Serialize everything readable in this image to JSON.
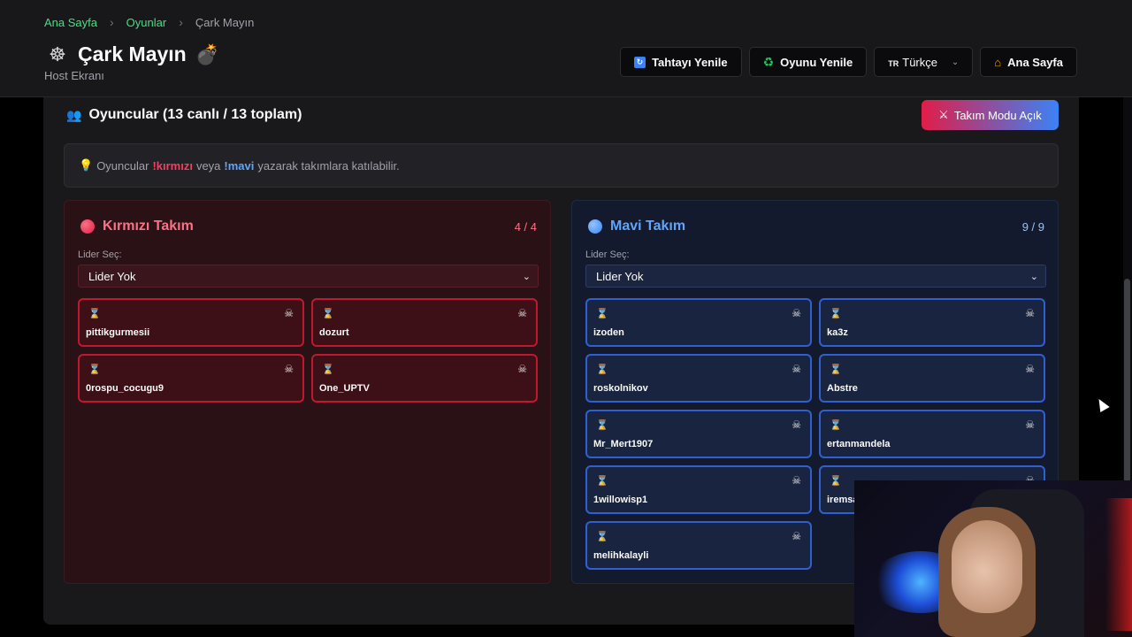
{
  "breadcrumb": {
    "home": "Ana Sayfa",
    "games": "Oyunlar",
    "current": "Çark Mayın",
    "sep": "›"
  },
  "header": {
    "title_icon": "☸",
    "title": "Çark Mayın",
    "title_emoji": "💣",
    "subtitle": "Host Ekranı",
    "buttons": {
      "refresh_board": "Tahtayı Yenile",
      "refresh_board_icon": "refresh-icon",
      "restart_game": "Oyunu Yenile",
      "restart_game_icon": "recycle-icon",
      "home": "Ana Sayfa",
      "home_icon": "house-icon"
    },
    "language": {
      "code": "TR",
      "label": "Türkçe"
    }
  },
  "players": {
    "icon": "users-icon",
    "title": "Oyuncular (13 canlı / 13 toplam)",
    "team_mode_button": "Takım Modu Açık",
    "info": {
      "prefix": "Oyuncular",
      "red_cmd": "!kırmızı",
      "mid": "veya",
      "blue_cmd": "!mavi",
      "suffix": "yazarak takımlara katılabilir."
    }
  },
  "teams": {
    "red": {
      "name": "Kırmızı Takım",
      "count": "4 / 4",
      "leader_label": "Lider Seç:",
      "leader_value": "Lider Yok",
      "players": [
        "pittikgurmesii",
        "dozurt",
        "0rospu_cocugu9",
        "One_UPTV"
      ]
    },
    "blue": {
      "name": "Mavi Takım",
      "count": "9 / 9",
      "leader_label": "Lider Seç:",
      "leader_value": "Lider Yok",
      "players": [
        "izoden",
        "ka3z",
        "roskolnikov",
        "Abstre",
        "Mr_Mert1907",
        "ertanmandela",
        "1willowisp1",
        "iremsa",
        "melihkalayli"
      ]
    }
  },
  "colors": {
    "accent_green": "#4ade80",
    "red": "#f43f5e",
    "blue": "#60a5fa"
  }
}
